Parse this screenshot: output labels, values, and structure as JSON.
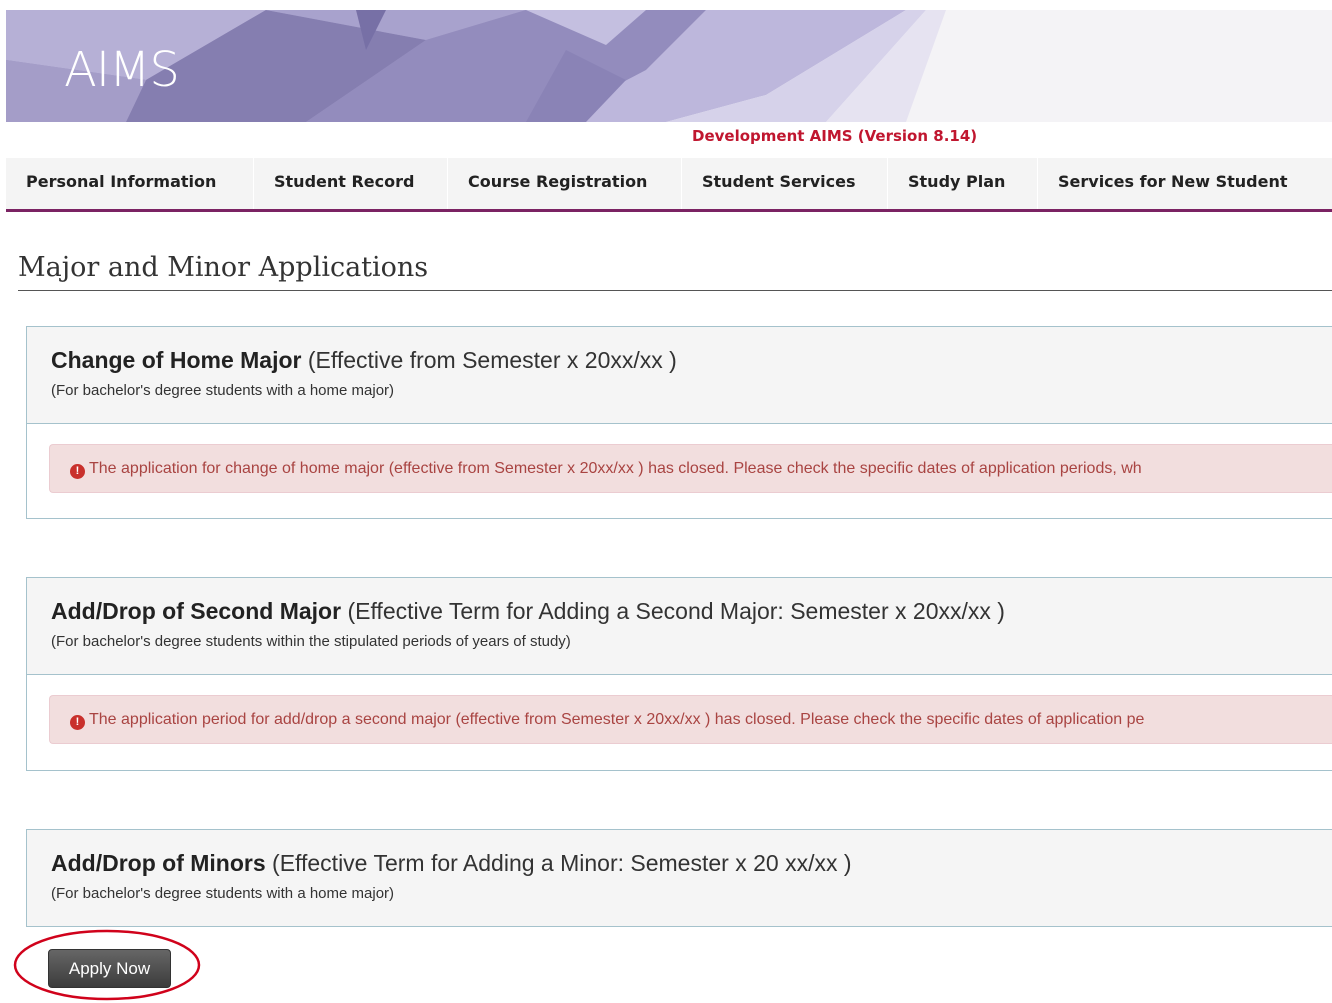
{
  "header": {
    "logo_text": "AIMS",
    "environment_label": "Development AIMS (Version 8.14)"
  },
  "nav": {
    "items": [
      {
        "label": "Personal Information"
      },
      {
        "label": "Student Record"
      },
      {
        "label": "Course Registration"
      },
      {
        "label": "Student Services"
      },
      {
        "label": "Study Plan"
      },
      {
        "label": "Services for New Student"
      }
    ]
  },
  "page": {
    "title": "Major and Minor Applications"
  },
  "sections": [
    {
      "title": "Change of Home Major",
      "term": " (Effective from Semester x 20xx/xx )",
      "subtitle": "(For bachelor's degree students with a home major)",
      "alert": "The application for change of home major (effective from Semester x 20xx/xx ) has closed. Please check the specific dates of application periods, wh"
    },
    {
      "title": "Add/Drop of Second Major",
      "term": " (Effective Term for Adding a Second Major: Semester x 20xx/xx )",
      "subtitle": "(For bachelor's degree students within the stipulated periods of years of study)",
      "alert": "The application period for add/drop a second major (effective from Semester x 20xx/xx ) has closed. Please check the specific dates of application pe"
    },
    {
      "title": "Add/Drop of Minors",
      "term": " (Effective Term for Adding a Minor: Semester x 20 xx/xx )",
      "subtitle": "(For bachelor's degree students with a home major)",
      "button_label": "Apply Now"
    }
  ],
  "colors": {
    "nav_underline": "#7b2363",
    "env_label": "#c0162f",
    "alert_bg": "#f2dede",
    "alert_text": "#a94442",
    "highlight_ring": "#d0021b"
  },
  "icons": {
    "alert": "exclamation-circle-icon"
  }
}
